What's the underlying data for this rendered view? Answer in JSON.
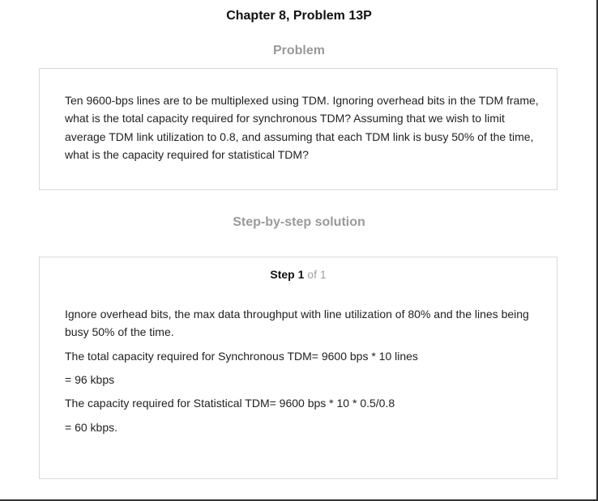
{
  "page": {
    "title": "Chapter 8, Problem 13P"
  },
  "problem": {
    "heading": "Problem",
    "text": "Ten 9600-bps lines are to be multiplexed using TDM. Ignoring overhead bits in the TDM frame, what is the total capacity required for synchronous TDM? Assuming that we wish to limit average TDM link utilization to 0.8, and assuming that each TDM link is busy 50% of the time, what is the capacity required for statistical TDM?"
  },
  "solution": {
    "heading": "Step-by-step solution",
    "step": {
      "label": "Step",
      "number": "1",
      "of_text": "of 1"
    },
    "lines": [
      "Ignore overhead bits, the max data throughput with line utilization of 80% and the lines being busy 50% of the time.",
      "The total capacity required for Synchronous TDM= 9600 bps * 10 lines",
      "= 96 kbps",
      "The capacity required for Statistical TDM= 9600 bps * 10 * 0.5/0.8",
      "= 60 kbps."
    ]
  }
}
